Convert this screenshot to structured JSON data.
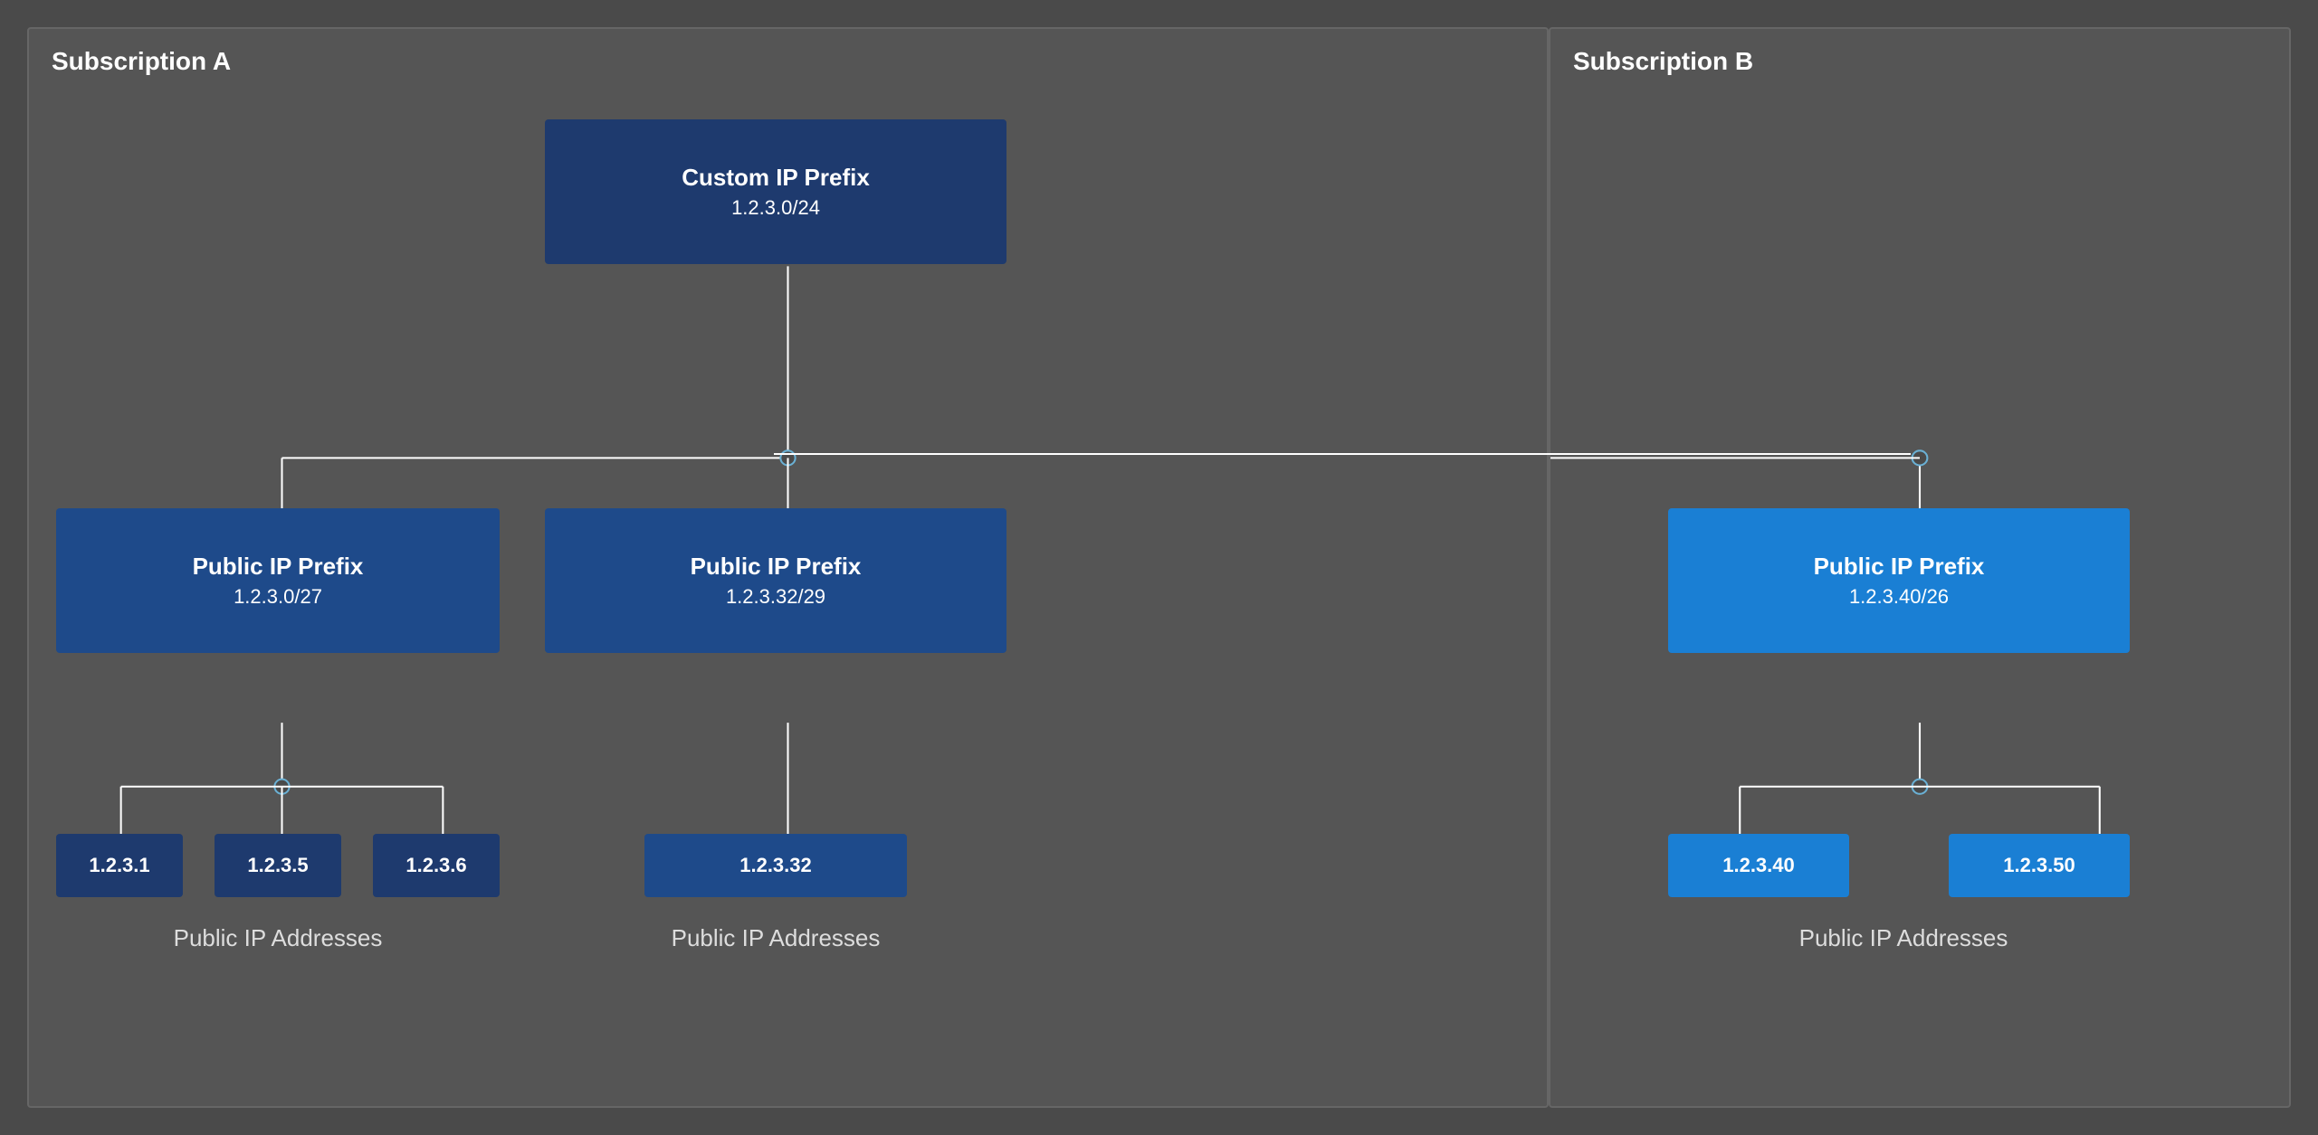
{
  "subscriptions": {
    "a": {
      "label": "Subscription A"
    },
    "b": {
      "label": "Subscription B"
    }
  },
  "custom_ip_prefix": {
    "title": "Custom IP Prefix",
    "subtitle": "1.2.3.0/24"
  },
  "public_ip_prefixes": [
    {
      "id": "prefix-1",
      "title": "Public IP Prefix",
      "subtitle": "1.2.3.0/27",
      "style": "dark-blue",
      "subscription": "a"
    },
    {
      "id": "prefix-2",
      "title": "Public IP Prefix",
      "subtitle": "1.2.3.32/29",
      "style": "dark-blue",
      "subscription": "a"
    },
    {
      "id": "prefix-3",
      "title": "Public IP Prefix",
      "subtitle": "1.2.3.40/26",
      "style": "bright-blue",
      "subscription": "b"
    }
  ],
  "public_ip_groups": [
    {
      "id": "group-1",
      "ips": [
        "1.2.3.1",
        "1.2.3.5",
        "1.2.3.6"
      ],
      "label": "Public IP Addresses",
      "style": "dark-blue",
      "parent_prefix": "prefix-1"
    },
    {
      "id": "group-2",
      "ips": [
        "1.2.3.32"
      ],
      "label": "Public IP Addresses",
      "style": "dark-blue",
      "parent_prefix": "prefix-2"
    },
    {
      "id": "group-3",
      "ips": [
        "1.2.3.40",
        "1.2.3.50"
      ],
      "label": "Public IP Addresses",
      "style": "bright-blue",
      "parent_prefix": "prefix-3"
    }
  ]
}
